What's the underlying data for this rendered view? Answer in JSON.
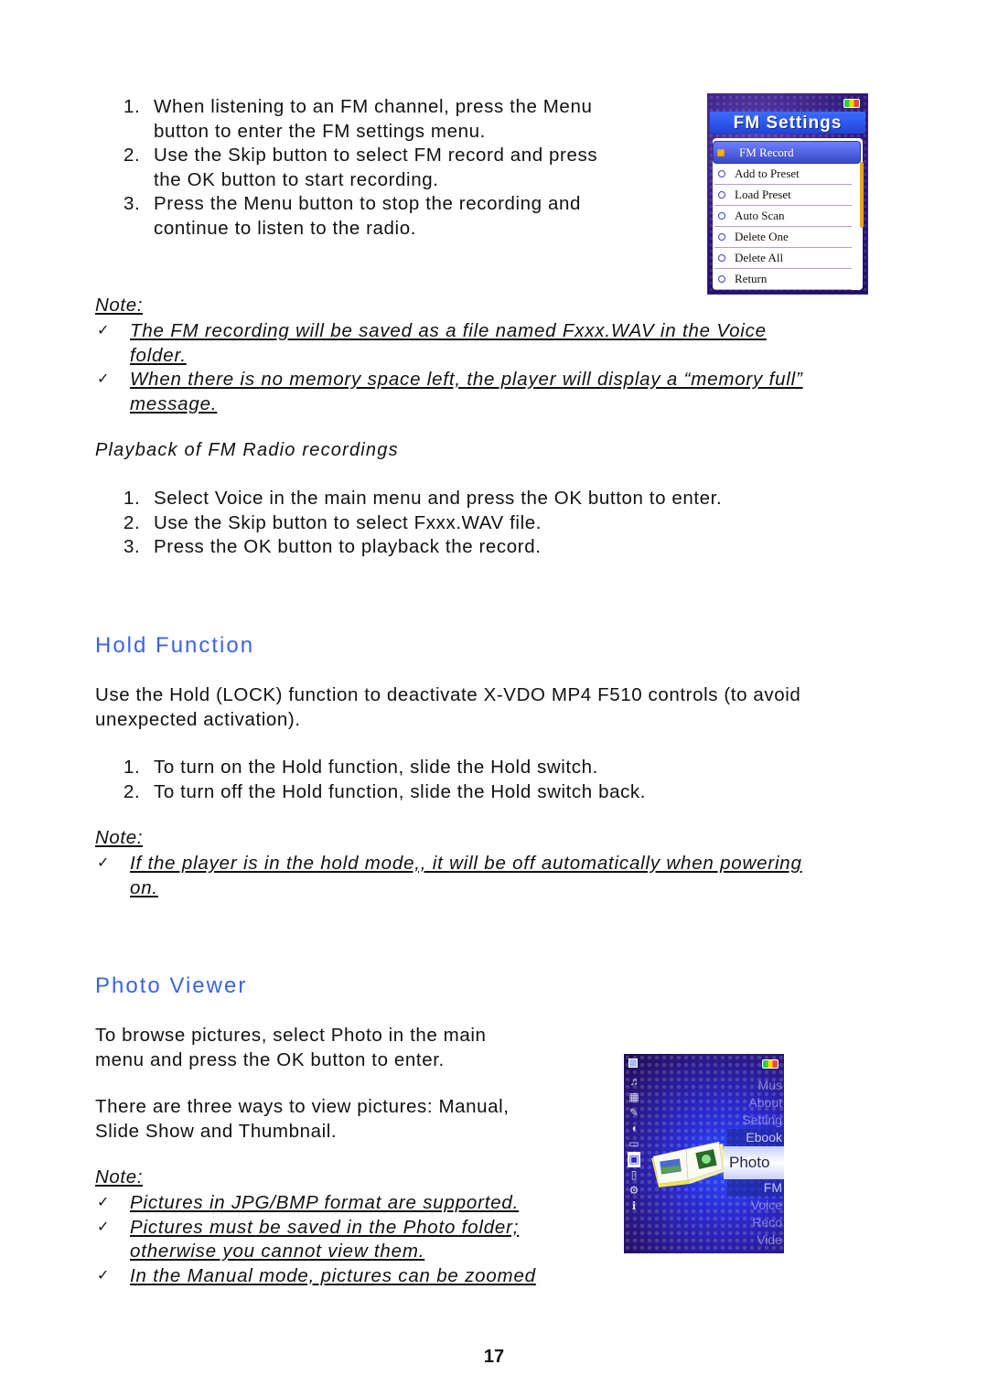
{
  "fm_record_steps": [
    {
      "num": "1.",
      "lines": [
        "When listening to an FM channel, press the Menu",
        "button to enter the FM settings menu."
      ]
    },
    {
      "num": "2.",
      "lines": [
        "Use the Skip button to select FM record and press",
        "the OK button to start recording."
      ]
    },
    {
      "num": "3.",
      "lines": [
        "Press the Menu button to stop the recording and",
        "continue to listen to the radio."
      ]
    }
  ],
  "fm_screen": {
    "title": "FM Settings",
    "items": [
      "FM Record",
      "Add to Preset",
      "Load Preset",
      "Auto Scan",
      "Delete One",
      "Delete All",
      "Return"
    ],
    "selected_index": 0
  },
  "note1": {
    "label": "Note:",
    "items": [
      {
        "lines": [
          "The FM recording will be saved as a file named Fxxx.WAV in the Voice",
          "folder."
        ]
      },
      {
        "lines": [
          "When there is no memory space left, the player will display a “memory full”",
          "message."
        ]
      }
    ]
  },
  "playback": {
    "heading": "Playback of FM Radio recordings",
    "steps": [
      {
        "num": "1.",
        "text": "Select Voice in the main menu and press the OK button to enter."
      },
      {
        "num": "2.",
        "text": "Use the Skip button to select Fxxx.WAV file."
      },
      {
        "num": "3.",
        "text": "Press the OK button to playback the record."
      }
    ]
  },
  "hold": {
    "heading": "Hold Function",
    "intro_lines": [
      "Use the Hold (LOCK) function to deactivate X-VDO MP4 F510 controls (to avoid",
      "unexpected activation)."
    ],
    "steps": [
      {
        "num": "1.",
        "text": "To turn on the Hold function, slide the Hold switch."
      },
      {
        "num": "2.",
        "text": "To turn off the Hold function, slide the Hold switch back."
      }
    ],
    "note_label": "Note:",
    "notes": [
      {
        "lines": [
          "If the player is in the hold mode,, it will be off automatically when powering",
          "on."
        ]
      }
    ]
  },
  "photo": {
    "heading": "Photo Viewer",
    "para1": [
      "To browse pictures, select Photo in the main",
      "menu and press the OK button to enter."
    ],
    "para2": [
      "There are three ways to view pictures: Manual,",
      "Slide Show and Thumbnail."
    ],
    "note_label": "Note:",
    "notes": [
      {
        "lines": [
          "Pictures in JPG/BMP format are supported. "
        ]
      },
      {
        "lines": [
          "Pictures must be saved in the Photo folder;",
          "otherwise you cannot view them."
        ]
      },
      {
        "lines": [
          "In the Manual mode, pictures can be zoomed"
        ]
      }
    ]
  },
  "photo_screen": {
    "menu": [
      "Mus",
      "About",
      "Setting",
      "Ebook",
      "Photo",
      "FM",
      "Voice",
      "Reco",
      "Vide"
    ],
    "selected": "Photo",
    "side_icons": [
      "music-icon",
      "video-icon",
      "record-icon",
      "voice-icon",
      "fm-icon",
      "photo-icon",
      "ebook-icon",
      "settings-icon",
      "about-icon"
    ]
  },
  "check_glyph": "✓",
  "page_number": "17"
}
